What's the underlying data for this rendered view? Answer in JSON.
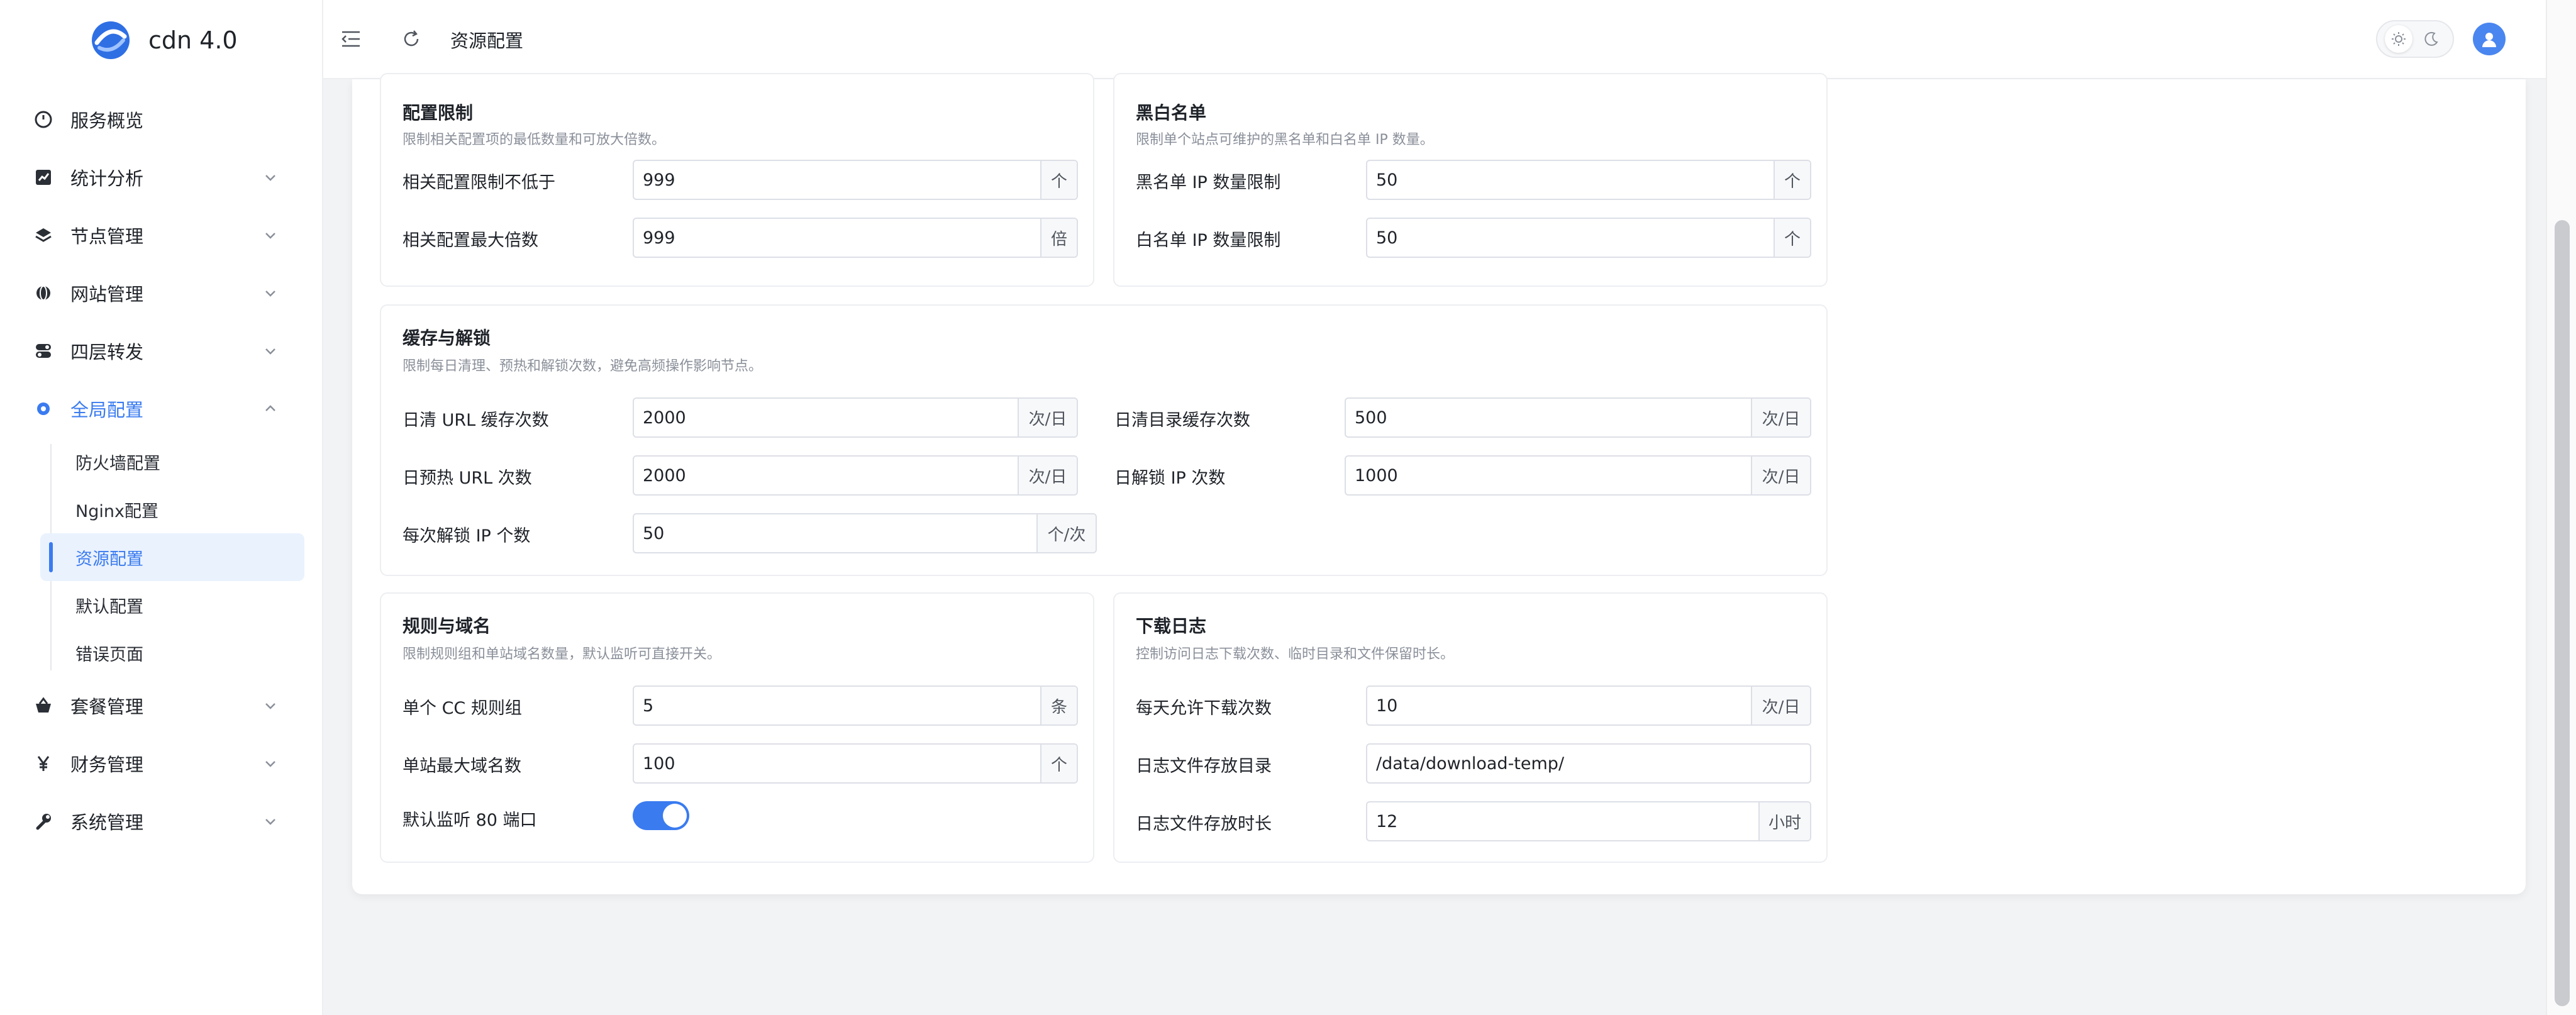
{
  "app": {
    "title": "cdn 4.0"
  },
  "header": {
    "breadcrumb": "资源配置"
  },
  "nav": {
    "items": [
      {
        "label": "服务概览"
      },
      {
        "label": "统计分析"
      },
      {
        "label": "节点管理"
      },
      {
        "label": "网站管理"
      },
      {
        "label": "四层转发"
      },
      {
        "label": "全局配置"
      },
      {
        "label": "套餐管理"
      },
      {
        "label": "财务管理"
      },
      {
        "label": "系统管理"
      }
    ],
    "global_sub": [
      {
        "label": "防火墙配置"
      },
      {
        "label": "Nginx配置"
      },
      {
        "label": "资源配置"
      },
      {
        "label": "默认配置"
      },
      {
        "label": "错误页面"
      }
    ]
  },
  "sections": {
    "config_limit": {
      "title": "配置限制",
      "desc": "限制相关配置项的最低数量和可放大倍数。",
      "fields": [
        {
          "label": "相关配置限制不低于",
          "value": "999",
          "suffix": "个"
        },
        {
          "label": "相关配置最大倍数",
          "value": "999",
          "suffix": "倍"
        }
      ]
    },
    "blackwhite": {
      "title": "黑白名单",
      "desc": "限制单个站点可维护的黑名单和白名单 IP 数量。",
      "fields": [
        {
          "label": "黑名单 IP 数量限制",
          "value": "50",
          "suffix": "个"
        },
        {
          "label": "白名单 IP 数量限制",
          "value": "50",
          "suffix": "个"
        }
      ]
    },
    "cache": {
      "title": "缓存与解锁",
      "desc": "限制每日清理、预热和解锁次数，避免高频操作影响节点。",
      "fields": [
        {
          "label": "日清 URL 缓存次数",
          "value": "2000",
          "suffix": "次/日"
        },
        {
          "label": "日清目录缓存次数",
          "value": "500",
          "suffix": "次/日"
        },
        {
          "label": "日预热 URL 次数",
          "value": "2000",
          "suffix": "次/日"
        },
        {
          "label": "日解锁 IP 次数",
          "value": "1000",
          "suffix": "次/日"
        },
        {
          "label": "每次解锁 IP 个数",
          "value": "50",
          "suffix": "个/次"
        }
      ]
    },
    "rules": {
      "title": "规则与域名",
      "desc": "限制规则组和单站域名数量，默认监听可直接开关。",
      "fields": [
        {
          "label": "单个 CC 规则组",
          "value": "5",
          "suffix": "条"
        },
        {
          "label": "单站最大域名数",
          "value": "100",
          "suffix": "个"
        },
        {
          "label": "默认监听 80 端口",
          "on": true
        }
      ]
    },
    "logs": {
      "title": "下载日志",
      "desc": "控制访问日志下载次数、临时目录和文件保留时长。",
      "fields": [
        {
          "label": "每天允许下载次数",
          "value": "10",
          "suffix": "次/日"
        },
        {
          "label": "日志文件存放目录",
          "value": "/data/download-temp/"
        },
        {
          "label": "日志文件存放时长",
          "value": "12",
          "suffix": "小时"
        }
      ]
    }
  },
  "colors": {
    "accent": "#3a7bf0",
    "background": "#f2f3f5"
  }
}
